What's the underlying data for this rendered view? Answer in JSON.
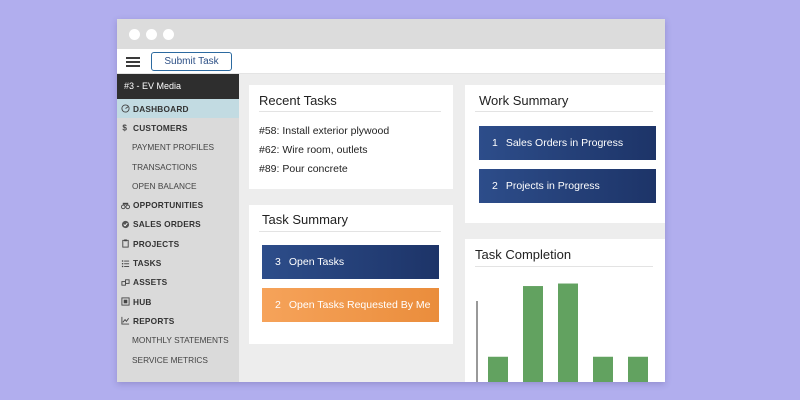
{
  "toolbar": {
    "submit_label": "Submit Task"
  },
  "sidebar": {
    "account": "#3 - EV Media",
    "items": [
      {
        "label": "DASHBOARD",
        "icon": "dashboard-icon",
        "type": "main",
        "active": true
      },
      {
        "label": "CUSTOMERS",
        "icon": "dollar-icon",
        "type": "main"
      },
      {
        "label": "PAYMENT PROFILES",
        "type": "sub"
      },
      {
        "label": "TRANSACTIONS",
        "type": "sub"
      },
      {
        "label": "OPEN BALANCE",
        "type": "sub"
      },
      {
        "label": "OPPORTUNITIES",
        "icon": "binoculars-icon",
        "type": "main"
      },
      {
        "label": "SALES ORDERS",
        "icon": "check-circle-icon",
        "type": "main"
      },
      {
        "label": "PROJECTS",
        "icon": "clipboard-icon",
        "type": "main"
      },
      {
        "label": "TASKS",
        "icon": "list-icon",
        "type": "main"
      },
      {
        "label": "ASSETS",
        "icon": "cubes-icon",
        "type": "main"
      },
      {
        "label": "HUB",
        "icon": "hub-icon",
        "type": "main"
      },
      {
        "label": "REPORTS",
        "icon": "chart-line-icon",
        "type": "main"
      },
      {
        "label": "MONTHLY STATEMENTS",
        "type": "sub"
      },
      {
        "label": "SERVICE METRICS",
        "type": "sub"
      }
    ]
  },
  "recent_tasks": {
    "title": "Recent Tasks",
    "items": [
      "#58: Install exterior plywood",
      "#62: Wire room, outlets",
      "#89: Pour concrete"
    ]
  },
  "task_summary": {
    "title": "Task Summary",
    "items": [
      {
        "count": "3",
        "label": "Open Tasks",
        "color": "#1f3a73"
      },
      {
        "count": "2",
        "label": "Open Tasks Requested By Me",
        "color": "#ef9445"
      }
    ]
  },
  "work_summary": {
    "title": "Work Summary",
    "items": [
      {
        "count": "1",
        "label": "Sales Orders in Progress",
        "color": "#1f3a73"
      },
      {
        "count": "2",
        "label": "Projects in Progress",
        "color": "#1f3a73"
      }
    ]
  },
  "task_completion": {
    "title": "Task Completion"
  },
  "chart_data": {
    "type": "bar",
    "title": "Task Completion",
    "categories": [
      "",
      "",
      "",
      "",
      ""
    ],
    "values": [
      1,
      3.8,
      3.9,
      1,
      1
    ],
    "ylim": [
      0,
      4
    ],
    "bar_color": "#62a260",
    "axis_color": "#333333"
  },
  "colors": {
    "background": "#b1aeee",
    "nav_blue": "#1f3a73",
    "accent_orange": "#ef9445",
    "active_nav": "#c2dbe2"
  }
}
